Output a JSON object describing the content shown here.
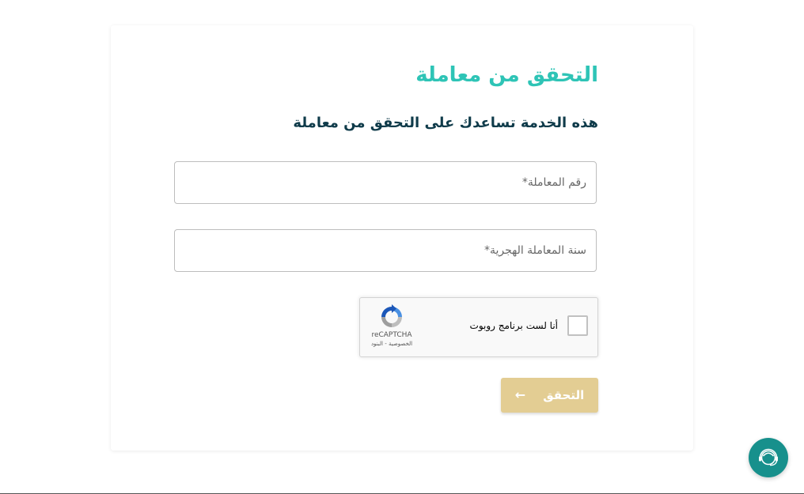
{
  "page": {
    "title": "التحقق من معاملة",
    "subtitle": "هذه الخدمة تساعدك على التحقق من معاملة"
  },
  "form": {
    "transaction_number_placeholder": "رقم المعاملة*",
    "transaction_number_value": "",
    "hijri_year_placeholder": "سنة المعاملة الهجرية*",
    "hijri_year_value": ""
  },
  "recaptcha": {
    "label": "أنا لست برنامج روبوت",
    "brand": "reCAPTCHA",
    "links": "الخصوصية - البنود",
    "checked": false
  },
  "actions": {
    "verify_label": "التحقق",
    "verify_icon": "arrow-left-icon"
  },
  "support": {
    "icon": "support-agent-icon"
  },
  "colors": {
    "title": "#2ec4b6",
    "subtitle": "#0f3b4a",
    "button": "#e3cd93",
    "fab": "#17908c"
  }
}
